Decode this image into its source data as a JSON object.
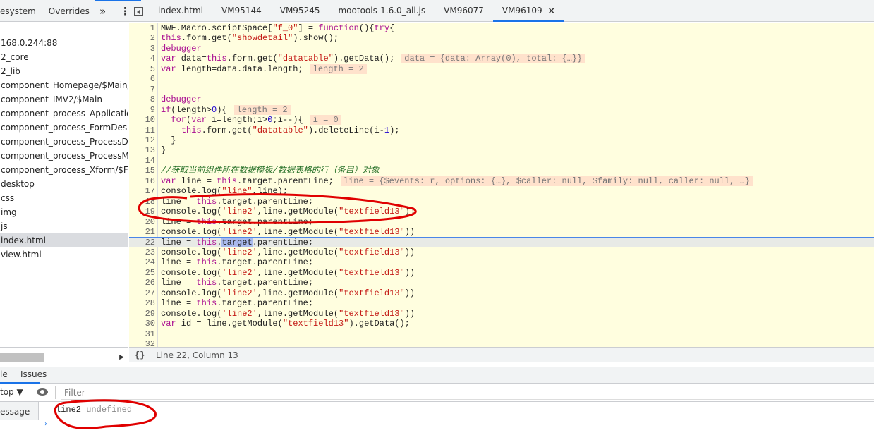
{
  "left_tabs": [
    "esystem",
    "Overrides",
    "»",
    "⋮"
  ],
  "file_tabs": [
    {
      "label": "index.html"
    },
    {
      "label": "VM95144"
    },
    {
      "label": "VM95245"
    },
    {
      "label": "mootools-1.6.0_all.js"
    },
    {
      "label": "VM96077"
    },
    {
      "label": "VM96109",
      "close": "×",
      "active": true
    }
  ],
  "sidebar": {
    "items": [
      "168.0.244:88",
      "2_core",
      "2_lib",
      "component_Homepage/$Main/de",
      "component_IMV2/$Main",
      "component_process_ApplicationEx",
      "component_process_FormDesigne",
      "component_process_ProcessDesig",
      "component_process_ProcessMana",
      "component_process_Xform/$Form",
      "desktop",
      "css",
      "img",
      "js",
      "index.html",
      "view.html"
    ],
    "selected": 14
  },
  "editor": {
    "current_line": 22,
    "lines": [
      "MWF.Macro.scriptSpace[\"f_0\"] = function(){try{",
      "this.form.get(\"showdetail\").show();",
      "debugger",
      "var data=this.form.get(\"datatable\").getData();",
      "var length=data.data.length;",
      "",
      "",
      "debugger",
      "if(length>0){",
      "  for(var i=length;i>0;i--){",
      "    this.form.get(\"datatable\").deleteLine(i-1);",
      "  }",
      "}",
      "",
      "//获取当前组件所在数据模板/数据表格的行（条目）对象",
      "var line = this.target.parentLine;",
      "console.log(\"line\",line);",
      "line = this.target.parentLine;",
      "console.log('line2',line.getModule(\"textfield13\"))",
      "line = this.target.parentLine;",
      "console.log('line2',line.getModule(\"textfield13\"))",
      "line = this.target.parentLine;",
      "console.log('line2',line.getModule(\"textfield13\"))",
      "line = this.target.parentLine;",
      "console.log('line2',line.getModule(\"textfield13\"))",
      "line = this.target.parentLine;",
      "console.log('line2',line.getModule(\"textfield13\"))",
      "line = this.target.parentLine;",
      "console.log('line2',line.getModule(\"textfield13\"))",
      "var id = line.getModule(\"textfield13\").getData();",
      "",
      ""
    ],
    "inline_values": {
      "4": "data = {data: Array(0), total: {…}}",
      "5": "length = 2",
      "9": "length = 2",
      "10": "i = 0",
      "16": "line = {$events: r, options: {…}, $caller: null, $family: null, caller: null, …}"
    }
  },
  "status": {
    "brace_icon": "{}",
    "position": "Line 22, Column 13"
  },
  "drawer": {
    "tabs": [
      "le",
      "Issues"
    ],
    "context": "top ▼",
    "filter_placeholder": "Filter",
    "sidebar_label": "essage",
    "message": {
      "label": "line2",
      "value": "undefined"
    },
    "prompt": "›"
  },
  "colors": {
    "accent": "#1a73e8",
    "editor_bg": "#fffedf",
    "annotation": "#e00000"
  }
}
